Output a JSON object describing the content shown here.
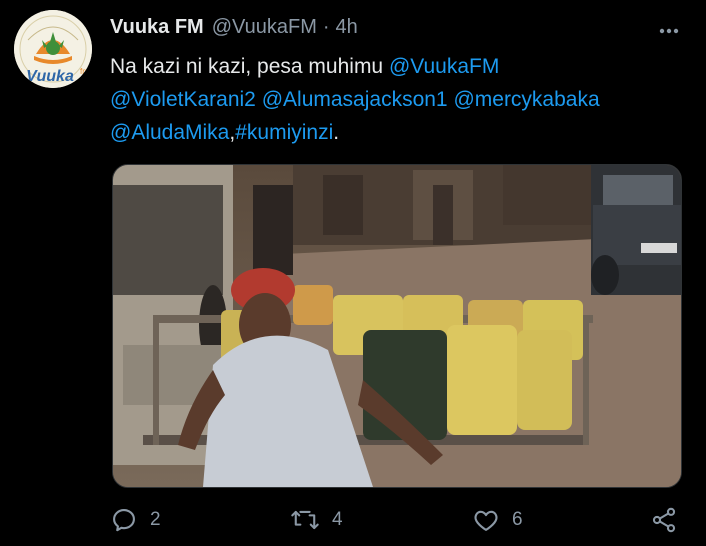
{
  "tweet": {
    "display_name": "Vuuka FM",
    "handle": "@VuukaFM",
    "separator": "·",
    "time": "4h",
    "text_prefix": "Na kazi ni kazi, pesa muhimu ",
    "mentions": [
      "@VuukaFM",
      "@VioletKarani2",
      "@Alumasajackson1",
      "@mercykabaka",
      "@AludaMika"
    ],
    "comma": ",",
    "hashtag": "#kumiyinzi",
    "period": "."
  },
  "avatar": {
    "logo_text": "Vuuka",
    "logo_suffix": "fm"
  },
  "more_icon": "more-horizontal-icon",
  "actions": {
    "reply_count": "2",
    "retweet_count": "4",
    "like_count": "6"
  },
  "colors": {
    "background": "#000000",
    "link": "#1d9bf0",
    "secondary": "#8b98a5",
    "logo_orange": "#e8892b",
    "logo_green": "#3f8f3a"
  }
}
